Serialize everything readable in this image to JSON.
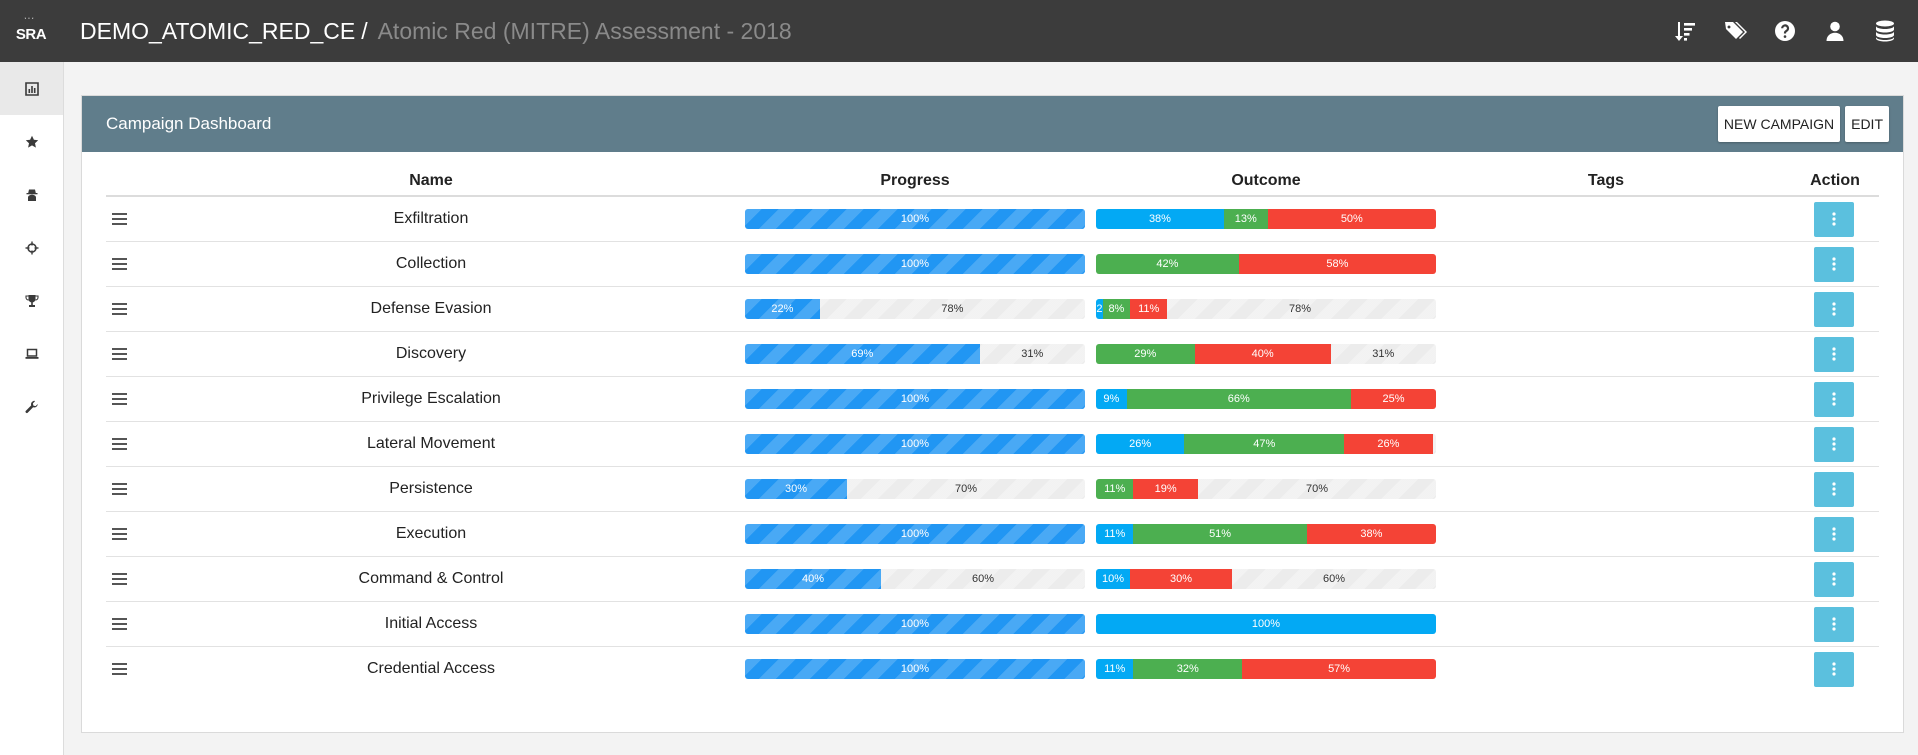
{
  "app": {
    "logo_text": "SRA",
    "breadcrumb_main": "DEMO_ATOMIC_RED_CE",
    "breadcrumb_sep": "/",
    "breadcrumb_sub": "Atomic Red (MITRE) Assessment - 2018"
  },
  "top_icons": [
    "sort-icon",
    "tags-icon",
    "help-icon",
    "user-icon",
    "database-icon"
  ],
  "sidebar": {
    "items": [
      "chart-icon",
      "star-icon",
      "spy-icon",
      "crosshair-icon",
      "trophy-icon",
      "laptop-icon",
      "wrench-icon"
    ],
    "active_index": 0
  },
  "panel": {
    "title": "Campaign Dashboard",
    "new_campaign_label": "NEW CAMPAIGN",
    "edit_label": "EDIT"
  },
  "table": {
    "headers": {
      "name": "Name",
      "progress": "Progress",
      "outcome": "Outcome",
      "tags": "Tags",
      "action": "Action"
    },
    "rows": [
      {
        "name": "Exfiltration",
        "progress": [
          {
            "value": 100,
            "label": "100%",
            "color": "#2196f3"
          }
        ],
        "outcome": [
          {
            "value": 38,
            "label": "38%",
            "color": "#03a9f4"
          },
          {
            "value": 13,
            "label": "13%",
            "color": "#4caf50"
          },
          {
            "value": 50,
            "label": "50%",
            "color": "#f44336"
          }
        ]
      },
      {
        "name": "Collection",
        "progress": [
          {
            "value": 100,
            "label": "100%",
            "color": "#2196f3"
          }
        ],
        "outcome": [
          {
            "value": 42,
            "label": "42%",
            "color": "#4caf50"
          },
          {
            "value": 58,
            "label": "58%",
            "color": "#f44336"
          }
        ]
      },
      {
        "name": "Defense Evasion",
        "progress": [
          {
            "value": 22,
            "label": "22%",
            "color": "#2196f3"
          },
          {
            "value": 78,
            "label": "78%",
            "color": ""
          }
        ],
        "outcome": [
          {
            "value": 2,
            "label": "2",
            "color": "#03a9f4"
          },
          {
            "value": 8,
            "label": "8%",
            "color": "#4caf50"
          },
          {
            "value": 11,
            "label": "11%",
            "color": "#f44336"
          },
          {
            "value": 78,
            "label": "78%",
            "color": ""
          }
        ]
      },
      {
        "name": "Discovery",
        "progress": [
          {
            "value": 69,
            "label": "69%",
            "color": "#2196f3"
          },
          {
            "value": 31,
            "label": "31%",
            "color": ""
          }
        ],
        "outcome": [
          {
            "value": 29,
            "label": "29%",
            "color": "#4caf50"
          },
          {
            "value": 40,
            "label": "40%",
            "color": "#f44336"
          },
          {
            "value": 31,
            "label": "31%",
            "color": ""
          }
        ]
      },
      {
        "name": "Privilege Escalation",
        "progress": [
          {
            "value": 100,
            "label": "100%",
            "color": "#2196f3"
          }
        ],
        "outcome": [
          {
            "value": 9,
            "label": "9%",
            "color": "#03a9f4"
          },
          {
            "value": 66,
            "label": "66%",
            "color": "#4caf50"
          },
          {
            "value": 25,
            "label": "25%",
            "color": "#f44336"
          }
        ]
      },
      {
        "name": "Lateral Movement",
        "progress": [
          {
            "value": 100,
            "label": "100%",
            "color": "#2196f3"
          }
        ],
        "outcome": [
          {
            "value": 26,
            "label": "26%",
            "color": "#03a9f4"
          },
          {
            "value": 47,
            "label": "47%",
            "color": "#4caf50"
          },
          {
            "value": 26,
            "label": "26%",
            "color": "#f44336"
          }
        ]
      },
      {
        "name": "Persistence",
        "progress": [
          {
            "value": 30,
            "label": "30%",
            "color": "#2196f3"
          },
          {
            "value": 70,
            "label": "70%",
            "color": ""
          }
        ],
        "outcome": [
          {
            "value": 11,
            "label": "11%",
            "color": "#4caf50"
          },
          {
            "value": 19,
            "label": "19%",
            "color": "#f44336"
          },
          {
            "value": 70,
            "label": "70%",
            "color": ""
          }
        ]
      },
      {
        "name": "Execution",
        "progress": [
          {
            "value": 100,
            "label": "100%",
            "color": "#2196f3"
          }
        ],
        "outcome": [
          {
            "value": 11,
            "label": "11%",
            "color": "#03a9f4"
          },
          {
            "value": 51,
            "label": "51%",
            "color": "#4caf50"
          },
          {
            "value": 38,
            "label": "38%",
            "color": "#f44336"
          }
        ]
      },
      {
        "name": "Command & Control",
        "progress": [
          {
            "value": 40,
            "label": "40%",
            "color": "#2196f3"
          },
          {
            "value": 60,
            "label": "60%",
            "color": ""
          }
        ],
        "outcome": [
          {
            "value": 10,
            "label": "10%",
            "color": "#03a9f4"
          },
          {
            "value": 30,
            "label": "30%",
            "color": "#f44336"
          },
          {
            "value": 60,
            "label": "60%",
            "color": ""
          }
        ]
      },
      {
        "name": "Initial Access",
        "progress": [
          {
            "value": 100,
            "label": "100%",
            "color": "#2196f3"
          }
        ],
        "outcome": [
          {
            "value": 100,
            "label": "100%",
            "color": "#03a9f4"
          }
        ]
      },
      {
        "name": "Credential Access",
        "progress": [
          {
            "value": 100,
            "label": "100%",
            "color": "#2196f3"
          }
        ],
        "outcome": [
          {
            "value": 11,
            "label": "11%",
            "color": "#03a9f4"
          },
          {
            "value": 32,
            "label": "32%",
            "color": "#4caf50"
          },
          {
            "value": 57,
            "label": "57%",
            "color": "#f44336"
          }
        ]
      }
    ]
  }
}
